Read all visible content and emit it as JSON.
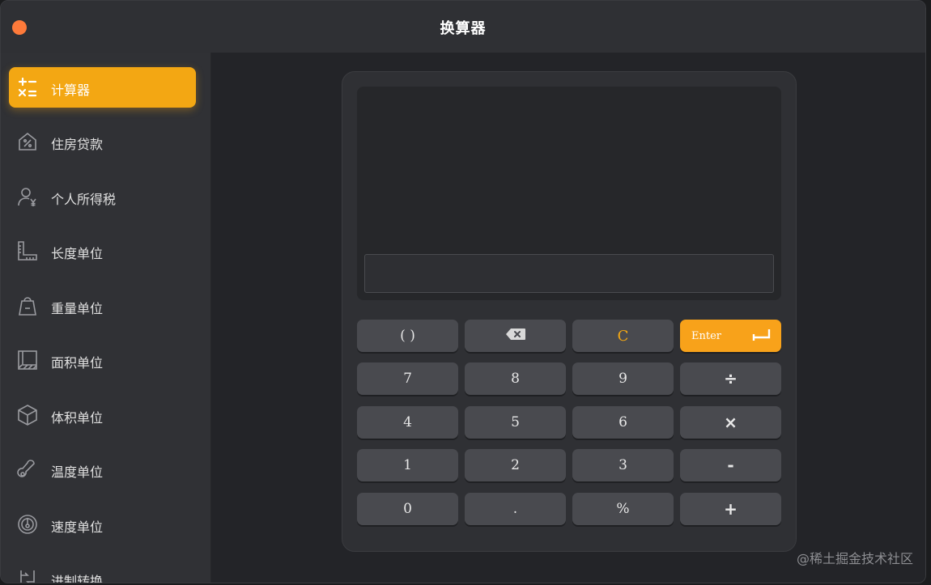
{
  "window": {
    "title": "换算器"
  },
  "sidebar": {
    "items": [
      {
        "label": "计算器",
        "icon": "calculator-icon",
        "active": true
      },
      {
        "label": "住房贷款",
        "icon": "house-percent-icon"
      },
      {
        "label": "个人所得税",
        "icon": "person-yen-icon"
      },
      {
        "label": "长度单位",
        "icon": "ruler-icon"
      },
      {
        "label": "重量单位",
        "icon": "weight-icon"
      },
      {
        "label": "面积单位",
        "icon": "area-icon"
      },
      {
        "label": "体积单位",
        "icon": "cube-icon"
      },
      {
        "label": "温度单位",
        "icon": "thermometer-icon"
      },
      {
        "label": "速度单位",
        "icon": "speedometer-icon"
      },
      {
        "label": "进制转换",
        "icon": "base-convert-icon"
      }
    ]
  },
  "calculator": {
    "display_value": "",
    "keys": {
      "parens": "(    )",
      "backspace": "⌫",
      "clear": "C",
      "enter": "Enter",
      "seven": "7",
      "eight": "8",
      "nine": "9",
      "divide": "÷",
      "four": "4",
      "five": "5",
      "six": "6",
      "multiply": "×",
      "one": "1",
      "two": "2",
      "three": "3",
      "minus": "-",
      "zero": "0",
      "dot": ".",
      "percent": "%",
      "plus": "+"
    }
  },
  "colors": {
    "accent": "#f3a713",
    "close": "#fe7a3a"
  },
  "watermark": "@稀土掘金技术社区"
}
